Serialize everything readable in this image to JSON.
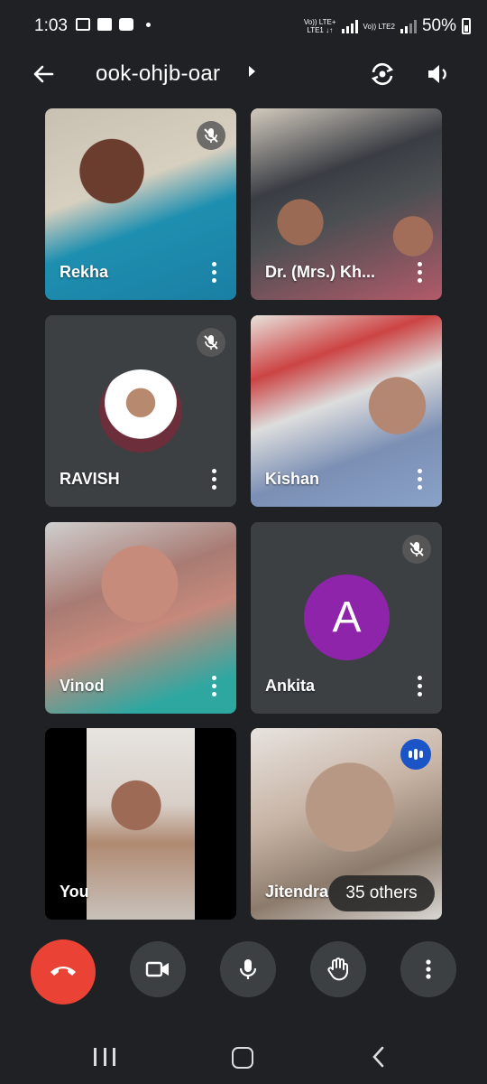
{
  "status_bar": {
    "time": "1:03",
    "network_1": "Vo)) LTE+\nLTE1 ↓↑",
    "network_2": "Vo)) LTE2",
    "battery": "50%"
  },
  "header": {
    "meeting_code": "ook-ohjb-oar",
    "icons": [
      "back-arrow-icon",
      "flip-camera-icon",
      "speaker-icon"
    ]
  },
  "participants": [
    {
      "name": "Rekha",
      "muted": true
    },
    {
      "name": "Dr. (Mrs.) Kh...",
      "muted": false
    },
    {
      "name": "RAVISH",
      "muted": true,
      "avatar": "photo"
    },
    {
      "name": "Kishan",
      "muted": false
    },
    {
      "name": "Vinod",
      "muted": false
    },
    {
      "name": "Ankita",
      "muted": true,
      "avatar_letter": "A"
    },
    {
      "name": "You",
      "muted": false
    },
    {
      "name": "Jitendra",
      "speaking": true
    }
  ],
  "others_badge": "35 others",
  "colors": {
    "background": "#202124",
    "tile": "#3c4043",
    "end_call": "#ea4335",
    "avatar_purple": "#8e24aa",
    "speaking_blue": "#1a54c7"
  },
  "controls": [
    "end-call",
    "camera",
    "microphone",
    "raise-hand",
    "more-options"
  ]
}
